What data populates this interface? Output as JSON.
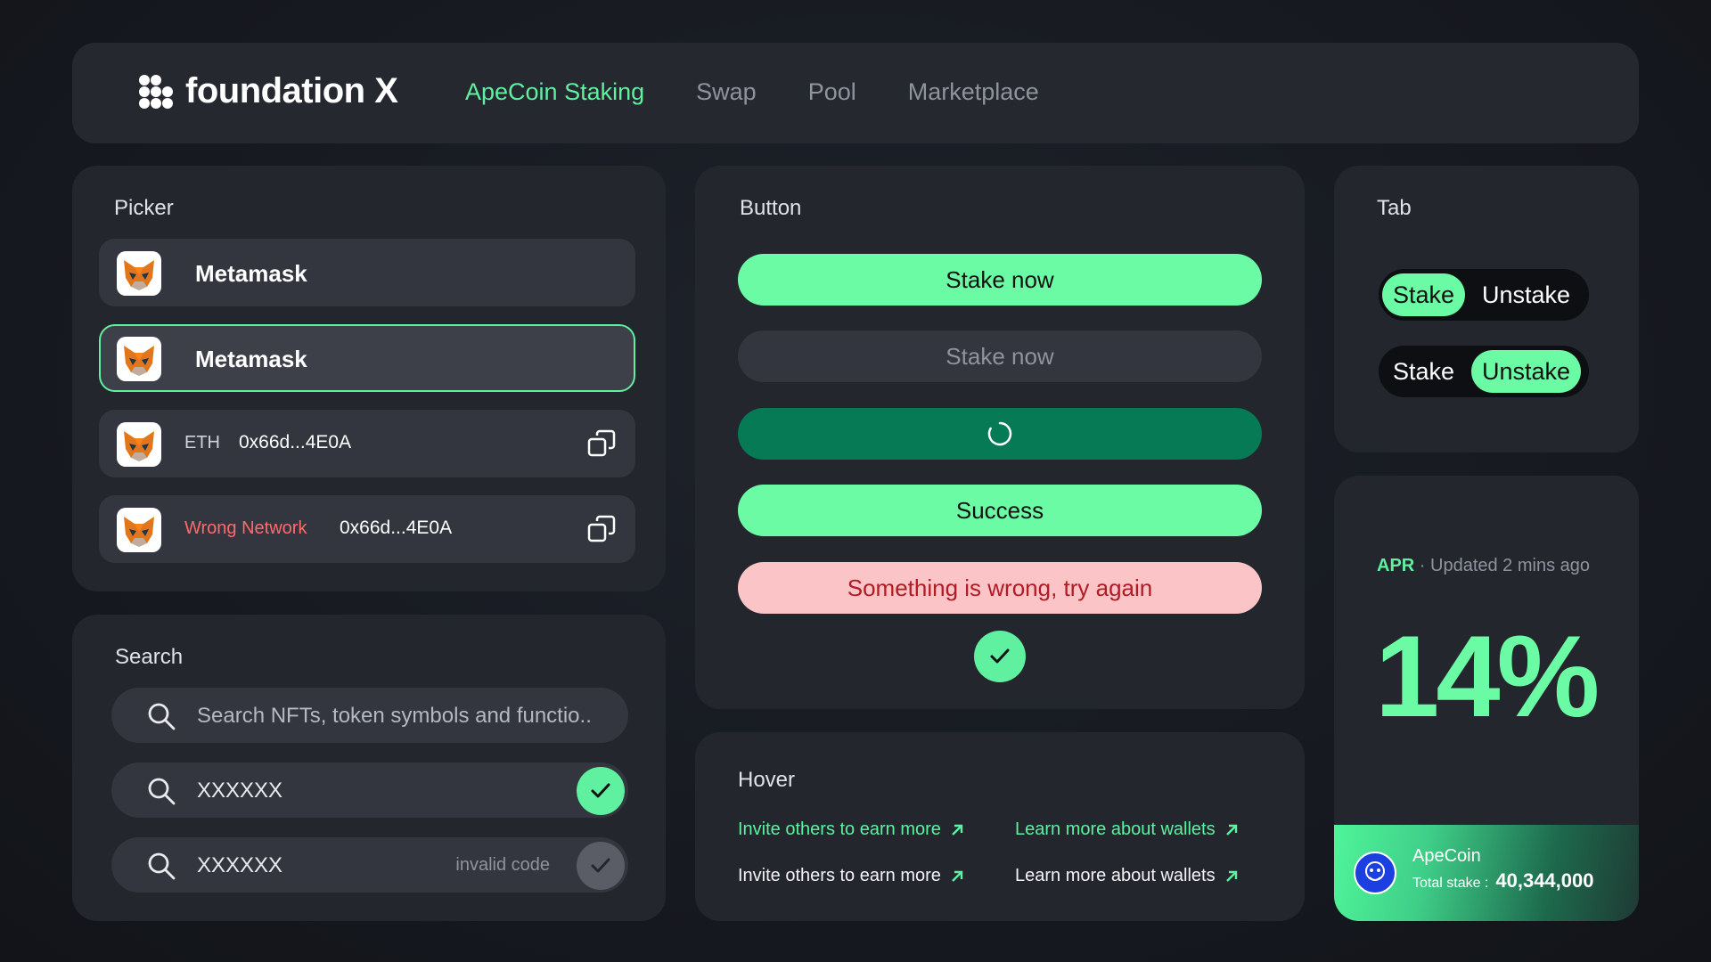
{
  "brand": {
    "name": "foundation X"
  },
  "nav": [
    {
      "label": "ApeCoin Staking",
      "active": true
    },
    {
      "label": "Swap",
      "active": false
    },
    {
      "label": "Pool",
      "active": false
    },
    {
      "label": "Marketplace",
      "active": false
    }
  ],
  "picker": {
    "title": "Picker",
    "rows": [
      {
        "name": "Metamask"
      },
      {
        "name": "Metamask",
        "selected": true
      },
      {
        "network": "ETH",
        "address": "0x66d...4E0A"
      },
      {
        "network": "Wrong Network",
        "address": "0x66d...4E0A"
      }
    ]
  },
  "search": {
    "title": "Search",
    "placeholder": "Search NFTs, token symbols and functio..",
    "value_valid": "XXXXXX",
    "value_invalid": "XXXXXX",
    "invalid_hint": "invalid code"
  },
  "buttons": {
    "title": "Button",
    "primary": "Stake now",
    "disabled": "Stake now",
    "success": "Success",
    "error": "Something is wrong, try again"
  },
  "hover": {
    "title": "Hover",
    "link_invite": "Invite others to earn more",
    "link_wallets": "Learn more about wallets"
  },
  "tabs": {
    "title": "Tab",
    "stake": "Stake",
    "unstake": "Unstake"
  },
  "apr": {
    "label": "APR",
    "updated": "· Updated 2 mins ago",
    "value": "14%",
    "token": "ApeCoin",
    "stake_label": "Total stake :",
    "stake_value": "40,344,000"
  },
  "colors": {
    "accent": "#6bfba4",
    "loading": "#067a55",
    "error_bg": "#fbc4c7",
    "error_text": "#b01b24",
    "wrong_network": "#ff6b6b"
  }
}
